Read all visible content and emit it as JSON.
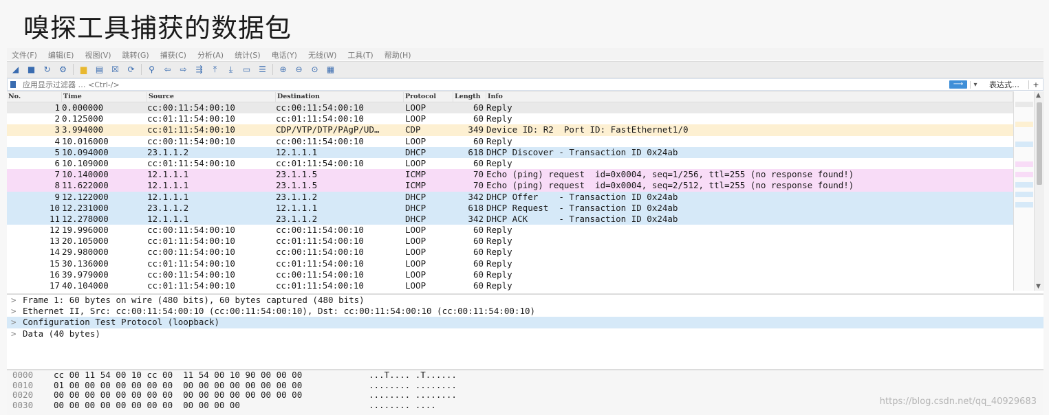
{
  "slide_title": "嗅探工具捕获的数据包",
  "menu": [
    "文件(F)",
    "编辑(E)",
    "视图(V)",
    "跳转(G)",
    "捕获(C)",
    "分析(A)",
    "统计(S)",
    "电话(Y)",
    "无线(W)",
    "工具(T)",
    "帮助(H)"
  ],
  "toolbar_icons": [
    "shark-fin-start-icon",
    "stop-square-icon",
    "restart-icon",
    "options-gear-icon",
    "open-folder-icon",
    "save-file-icon",
    "close-file-icon",
    "reload-icon",
    "find-magnifier-icon",
    "go-back-arrow-icon",
    "go-forward-arrow-icon",
    "go-to-packet-icon",
    "first-packet-icon",
    "last-packet-icon",
    "autoscroll-icon",
    "colorize-icon",
    "zoom-in-icon",
    "zoom-out-icon",
    "normal-size-icon",
    "resize-columns-icon"
  ],
  "filter": {
    "placeholder": "应用显示过滤器 … <Ctrl-/>",
    "arrow_label": "⟶",
    "dropdown_label": "▾",
    "expression_label": "表达式…",
    "plus_label": "+"
  },
  "columns": {
    "no": "No.",
    "time": "Time",
    "source": "Source",
    "destination": "Destination",
    "protocol": "Protocol",
    "length": "Length",
    "info": "Info"
  },
  "colors": {
    "loop": "#ffffff",
    "cdp": "#fdf0d2",
    "dhcp": "#d6e9f8",
    "icmp": "#f8dcf7",
    "selected": "#e9e9e9"
  },
  "packets": [
    {
      "no": "1",
      "time": "0.000000",
      "src": "cc:00:11:54:00:10",
      "dst": "cc:00:11:54:00:10",
      "proto": "LOOP",
      "len": "60",
      "info": "Reply",
      "cls": "bg-sel"
    },
    {
      "no": "2",
      "time": "0.125000",
      "src": "cc:01:11:54:00:10",
      "dst": "cc:01:11:54:00:10",
      "proto": "LOOP",
      "len": "60",
      "info": "Reply",
      "cls": "bg-loop"
    },
    {
      "no": "3",
      "time": "3.994000",
      "src": "cc:01:11:54:00:10",
      "dst": "CDP/VTP/DTP/PAgP/UD…",
      "proto": "CDP",
      "len": "349",
      "info": "Device ID: R2  Port ID: FastEthernet1/0",
      "cls": "bg-cdp"
    },
    {
      "no": "4",
      "time": "10.016000",
      "src": "cc:00:11:54:00:10",
      "dst": "cc:00:11:54:00:10",
      "proto": "LOOP",
      "len": "60",
      "info": "Reply",
      "cls": "bg-loop"
    },
    {
      "no": "5",
      "time": "10.094000",
      "src": "23.1.1.2",
      "dst": "12.1.1.1",
      "proto": "DHCP",
      "len": "618",
      "info": "DHCP Discover - Transaction ID 0x24ab",
      "cls": "bg-dhcp"
    },
    {
      "no": "6",
      "time": "10.109000",
      "src": "cc:01:11:54:00:10",
      "dst": "cc:01:11:54:00:10",
      "proto": "LOOP",
      "len": "60",
      "info": "Reply",
      "cls": "bg-loop"
    },
    {
      "no": "7",
      "time": "10.140000",
      "src": "12.1.1.1",
      "dst": "23.1.1.5",
      "proto": "ICMP",
      "len": "70",
      "info": "Echo (ping) request  id=0x0004, seq=1/256, ttl=255 (no response found!)",
      "cls": "bg-icmp"
    },
    {
      "no": "8",
      "time": "11.622000",
      "src": "12.1.1.1",
      "dst": "23.1.1.5",
      "proto": "ICMP",
      "len": "70",
      "info": "Echo (ping) request  id=0x0004, seq=2/512, ttl=255 (no response found!)",
      "cls": "bg-icmp"
    },
    {
      "no": "9",
      "time": "12.122000",
      "src": "12.1.1.1",
      "dst": "23.1.1.2",
      "proto": "DHCP",
      "len": "342",
      "info": "DHCP Offer    - Transaction ID 0x24ab",
      "cls": "bg-dhcp"
    },
    {
      "no": "10",
      "time": "12.231000",
      "src": "23.1.1.2",
      "dst": "12.1.1.1",
      "proto": "DHCP",
      "len": "618",
      "info": "DHCP Request  - Transaction ID 0x24ab",
      "cls": "bg-dhcp"
    },
    {
      "no": "11",
      "time": "12.278000",
      "src": "12.1.1.1",
      "dst": "23.1.1.2",
      "proto": "DHCP",
      "len": "342",
      "info": "DHCP ACK      - Transaction ID 0x24ab",
      "cls": "bg-dhcp"
    },
    {
      "no": "12",
      "time": "19.996000",
      "src": "cc:00:11:54:00:10",
      "dst": "cc:00:11:54:00:10",
      "proto": "LOOP",
      "len": "60",
      "info": "Reply",
      "cls": "bg-loop"
    },
    {
      "no": "13",
      "time": "20.105000",
      "src": "cc:01:11:54:00:10",
      "dst": "cc:01:11:54:00:10",
      "proto": "LOOP",
      "len": "60",
      "info": "Reply",
      "cls": "bg-loop"
    },
    {
      "no": "14",
      "time": "29.980000",
      "src": "cc:00:11:54:00:10",
      "dst": "cc:00:11:54:00:10",
      "proto": "LOOP",
      "len": "60",
      "info": "Reply",
      "cls": "bg-loop"
    },
    {
      "no": "15",
      "time": "30.136000",
      "src": "cc:01:11:54:00:10",
      "dst": "cc:01:11:54:00:10",
      "proto": "LOOP",
      "len": "60",
      "info": "Reply",
      "cls": "bg-loop"
    },
    {
      "no": "16",
      "time": "39.979000",
      "src": "cc:00:11:54:00:10",
      "dst": "cc:00:11:54:00:10",
      "proto": "LOOP",
      "len": "60",
      "info": "Reply",
      "cls": "bg-loop"
    },
    {
      "no": "17",
      "time": "40.104000",
      "src": "cc:01:11:54:00:10",
      "dst": "cc:01:11:54:00:10",
      "proto": "LOOP",
      "len": "60",
      "info": "Reply",
      "cls": "bg-loop"
    }
  ],
  "details": [
    {
      "chevron": ">",
      "text": "Frame 1: 60 bytes on wire (480 bits), 60 bytes captured (480 bits)",
      "selected": false
    },
    {
      "chevron": ">",
      "text": "Ethernet II, Src: cc:00:11:54:00:10 (cc:00:11:54:00:10), Dst: cc:00:11:54:00:10 (cc:00:11:54:00:10)",
      "selected": false
    },
    {
      "chevron": ">",
      "text": "Configuration Test Protocol (loopback)",
      "selected": true
    },
    {
      "chevron": ">",
      "text": "Data (40 bytes)",
      "selected": false
    }
  ],
  "bytes": [
    {
      "offset": "0000",
      "hex": "cc 00 11 54 00 10 cc 00  11 54 00 10 90 00 00 00",
      "ascii": "...T.... .T......"
    },
    {
      "offset": "0010",
      "hex": "01 00 00 00 00 00 00 00  00 00 00 00 00 00 00 00",
      "ascii": "........ ........"
    },
    {
      "offset": "0020",
      "hex": "00 00 00 00 00 00 00 00  00 00 00 00 00 00 00 00",
      "ascii": "........ ........"
    },
    {
      "offset": "0030",
      "hex": "00 00 00 00 00 00 00 00  00 00 00 00",
      "ascii": "........ ...."
    }
  ],
  "watermark": "https://blog.csdn.net/qq_40929683"
}
